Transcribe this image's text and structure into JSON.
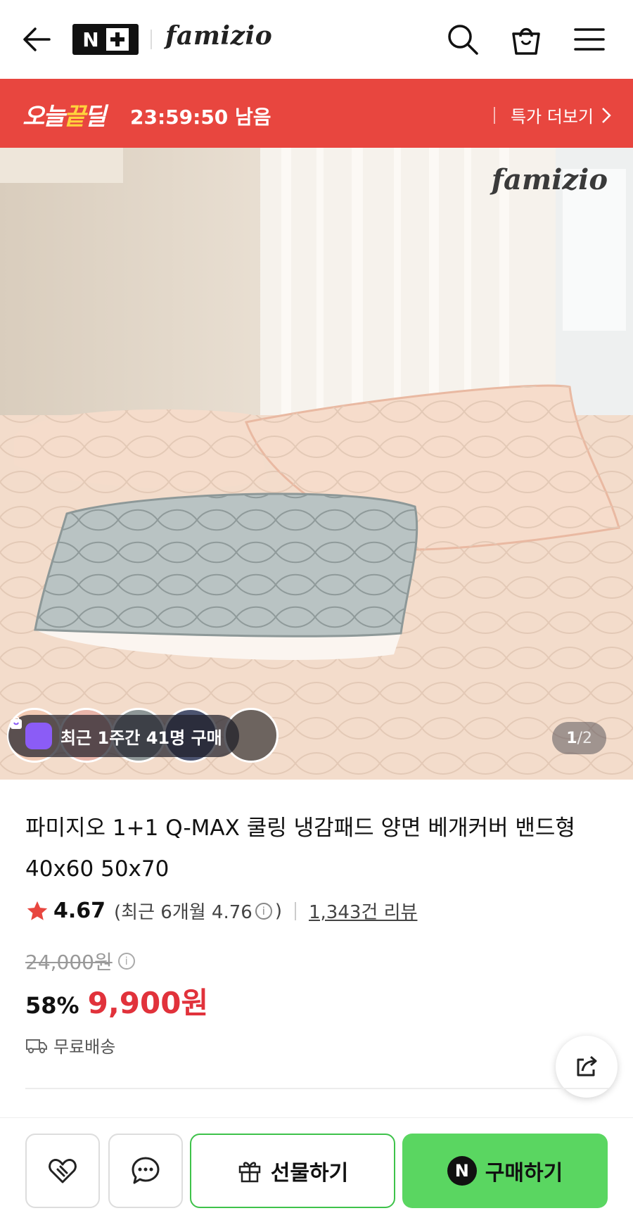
{
  "header": {
    "nplus_letter": "N",
    "brand": "famizio",
    "icons": [
      "back-arrow-icon",
      "search-icon",
      "shopping-bag-icon",
      "menu-icon"
    ]
  },
  "deal": {
    "label_prefix": "오늘",
    "label_highlight": "끝",
    "label_suffix": "딜",
    "timer": "23:59:50 남음",
    "more": "특가 더보기",
    "bg_color": "#e8463f"
  },
  "hero": {
    "watermark": "famizio",
    "buyers_text": "최근 1주간 41명 구매",
    "counter_current": "1",
    "counter_sep": " / ",
    "counter_total": "2"
  },
  "product": {
    "title": "파미지오 1+1 Q-MAX 쿨링 냉감패드 양면 베개커버 밴드형 40x60 50x70",
    "rating_score": "4.67",
    "rating_recent_open": "(최근 6개월 4.76",
    "rating_info": "i",
    "rating_recent_close": ")",
    "review_count": "1,343건 리뷰",
    "original_price": "24,000원",
    "discount": "58%",
    "price": "9,900원",
    "shipping": "무료배송",
    "accent_color": "#e1323b"
  },
  "bottom_bar": {
    "gift_label": "선물하기",
    "buy_label": "구매하기",
    "buy_logo": "N",
    "buy_color": "#5ad661"
  }
}
